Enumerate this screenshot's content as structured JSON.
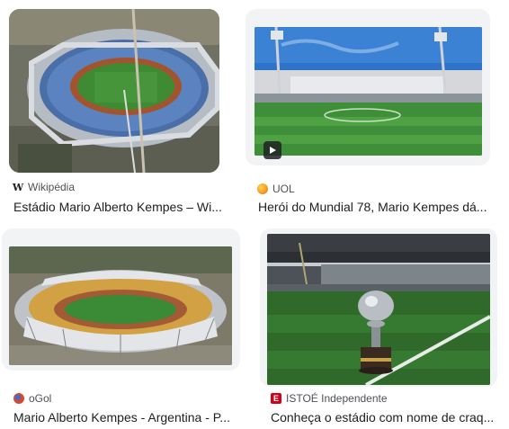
{
  "results": [
    {
      "source": "Wikipédia",
      "title": "Estádio Mario Alberto Kempes – Wi...",
      "favicon": "wikipedia-w-icon"
    },
    {
      "source": "UOL",
      "title": "Herói do Mundial 78, Mario Kempes dá...",
      "favicon": "uol-circle-icon",
      "favicon_color": "#f59a23",
      "has_video": true
    },
    {
      "source": "oGol",
      "title": "Mario Alberto Kempes - Argentina - P...",
      "favicon": "ogol-ball-icon",
      "favicon_color": "#d9482b"
    },
    {
      "source": "ISTOÉ Independente",
      "title": "Conheça o estádio com nome de craq...",
      "favicon": "istoe-e-icon",
      "favicon_color": "#d0021b"
    }
  ]
}
